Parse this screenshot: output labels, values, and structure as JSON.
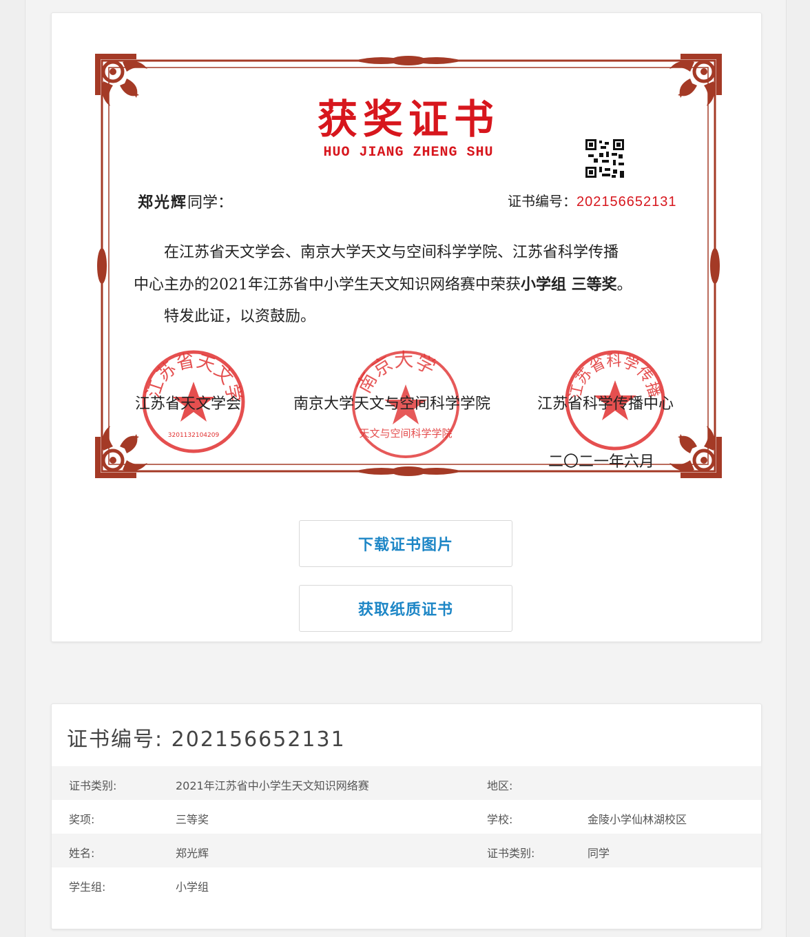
{
  "certificate": {
    "title": "获奖证书",
    "pinyin": "HUO JIANG ZHENG SHU",
    "recipient_name": "郑光辉",
    "recipient_suffix": "同学：",
    "number_label": "证书编号：",
    "number": "202156652131",
    "body_line1": "在江苏省天文学会、南京大学天文与空间科学学院、江苏省科学传播",
    "body_line2_prefix": "中心主办的2021年江苏省中小学生天文知识网络赛中荣获",
    "body_line2_award": "小学组 三等奖",
    "body_line2_suffix": "。",
    "body_line3": "特发此证，以资鼓励。",
    "issuer1": "江苏省天文学会",
    "issuer2": "南京大学天文与空间科学学院",
    "issuer3": "江苏省科学传播中心",
    "date": "二〇二一年六月",
    "seal1_text": "江苏省天文学会",
    "seal1_code": "3201132104209",
    "seal2_text": "南京大学",
    "seal2_sub": "天文与空间科学学院",
    "seal3_text": "江苏省科学传播中心"
  },
  "buttons": {
    "download": "下载证书图片",
    "paper": "获取纸质证书"
  },
  "info": {
    "title": "证书编号: 202156652131",
    "rows": [
      {
        "k1": "证书类别:",
        "v1": "2021年江苏省中小学生天文知识网络赛",
        "k2": "地区:",
        "v2": ""
      },
      {
        "k1": "奖项:",
        "v1": "三等奖",
        "k2": "学校:",
        "v2": "金陵小学仙林湖校区"
      },
      {
        "k1": "姓名:",
        "v1": "郑光辉",
        "k2": "证书类别:",
        "v2": "同学"
      },
      {
        "k1": "学生组:",
        "v1": "小学组",
        "k2": "",
        "v2": ""
      }
    ]
  },
  "colors": {
    "cert_red": "#d7161d",
    "frame_brown": "#a43a26",
    "button_blue": "#1d86c6"
  }
}
